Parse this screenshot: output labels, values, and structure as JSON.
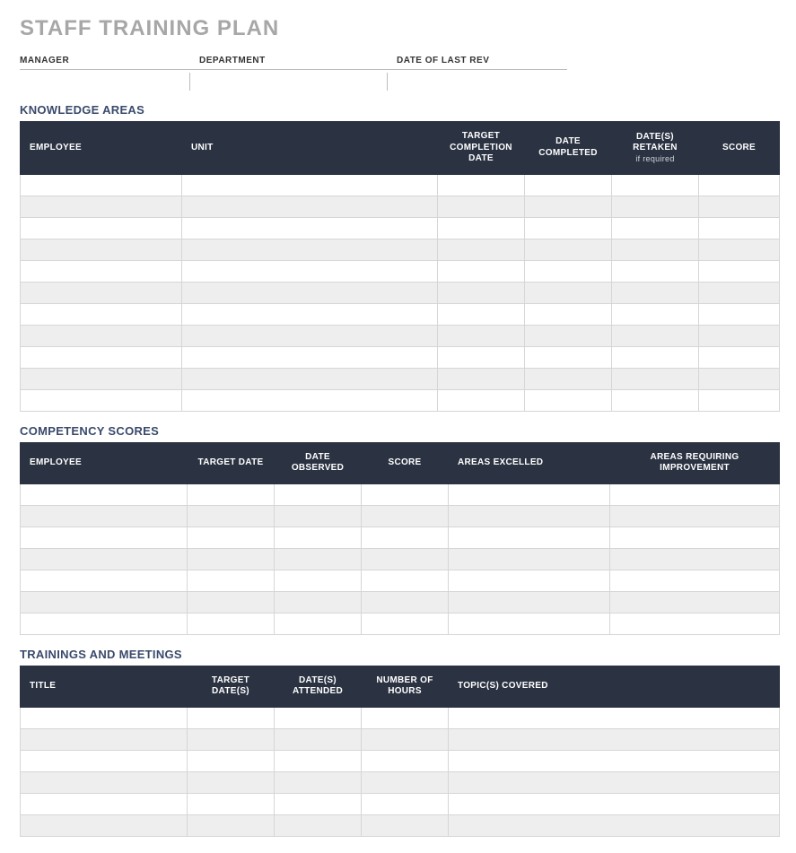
{
  "title": "STAFF TRAINING PLAN",
  "meta": {
    "manager_label": "MANAGER",
    "department_label": "DEPARTMENT",
    "date_last_rev_label": "DATE OF LAST REV",
    "manager_value": "",
    "department_value": "",
    "date_last_rev_value": ""
  },
  "sections": {
    "knowledge": {
      "heading": "KNOWLEDGE AREAS",
      "headers": {
        "employee": "EMPLOYEE",
        "unit": "UNIT",
        "target_completion": "TARGET COMPLETION DATE",
        "date_completed": "DATE COMPLETED",
        "dates_retaken": "DATE(S) RETAKEN",
        "dates_retaken_sub": "if required",
        "score": "SCORE"
      },
      "rows": [
        {
          "employee": "",
          "unit": "",
          "target_completion": "",
          "date_completed": "",
          "dates_retaken": "",
          "score": ""
        },
        {
          "employee": "",
          "unit": "",
          "target_completion": "",
          "date_completed": "",
          "dates_retaken": "",
          "score": ""
        },
        {
          "employee": "",
          "unit": "",
          "target_completion": "",
          "date_completed": "",
          "dates_retaken": "",
          "score": ""
        },
        {
          "employee": "",
          "unit": "",
          "target_completion": "",
          "date_completed": "",
          "dates_retaken": "",
          "score": ""
        },
        {
          "employee": "",
          "unit": "",
          "target_completion": "",
          "date_completed": "",
          "dates_retaken": "",
          "score": ""
        },
        {
          "employee": "",
          "unit": "",
          "target_completion": "",
          "date_completed": "",
          "dates_retaken": "",
          "score": ""
        },
        {
          "employee": "",
          "unit": "",
          "target_completion": "",
          "date_completed": "",
          "dates_retaken": "",
          "score": ""
        },
        {
          "employee": "",
          "unit": "",
          "target_completion": "",
          "date_completed": "",
          "dates_retaken": "",
          "score": ""
        },
        {
          "employee": "",
          "unit": "",
          "target_completion": "",
          "date_completed": "",
          "dates_retaken": "",
          "score": ""
        },
        {
          "employee": "",
          "unit": "",
          "target_completion": "",
          "date_completed": "",
          "dates_retaken": "",
          "score": ""
        },
        {
          "employee": "",
          "unit": "",
          "target_completion": "",
          "date_completed": "",
          "dates_retaken": "",
          "score": ""
        }
      ]
    },
    "competency": {
      "heading": "COMPETENCY SCORES",
      "headers": {
        "employee": "EMPLOYEE",
        "target_date": "TARGET DATE",
        "date_observed": "DATE OBSERVED",
        "score": "SCORE",
        "areas_excelled": "AREAS EXCELLED",
        "areas_improvement": "AREAS REQUIRING IMPROVEMENT"
      },
      "rows": [
        {
          "employee": "",
          "target_date": "",
          "date_observed": "",
          "score": "",
          "areas_excelled": "",
          "areas_improvement": ""
        },
        {
          "employee": "",
          "target_date": "",
          "date_observed": "",
          "score": "",
          "areas_excelled": "",
          "areas_improvement": ""
        },
        {
          "employee": "",
          "target_date": "",
          "date_observed": "",
          "score": "",
          "areas_excelled": "",
          "areas_improvement": ""
        },
        {
          "employee": "",
          "target_date": "",
          "date_observed": "",
          "score": "",
          "areas_excelled": "",
          "areas_improvement": ""
        },
        {
          "employee": "",
          "target_date": "",
          "date_observed": "",
          "score": "",
          "areas_excelled": "",
          "areas_improvement": ""
        },
        {
          "employee": "",
          "target_date": "",
          "date_observed": "",
          "score": "",
          "areas_excelled": "",
          "areas_improvement": ""
        },
        {
          "employee": "",
          "target_date": "",
          "date_observed": "",
          "score": "",
          "areas_excelled": "",
          "areas_improvement": ""
        }
      ]
    },
    "trainings": {
      "heading": "TRAININGS AND MEETINGS",
      "headers": {
        "title": "TITLE",
        "target_dates": "TARGET DATE(S)",
        "dates_attended": "DATE(S) ATTENDED",
        "number_of_hours": "NUMBER OF HOURS",
        "topics_covered": "TOPIC(S) COVERED"
      },
      "rows": [
        {
          "title": "",
          "target_dates": "",
          "dates_attended": "",
          "number_of_hours": "",
          "topics_covered": ""
        },
        {
          "title": "",
          "target_dates": "",
          "dates_attended": "",
          "number_of_hours": "",
          "topics_covered": ""
        },
        {
          "title": "",
          "target_dates": "",
          "dates_attended": "",
          "number_of_hours": "",
          "topics_covered": ""
        },
        {
          "title": "",
          "target_dates": "",
          "dates_attended": "",
          "number_of_hours": "",
          "topics_covered": ""
        },
        {
          "title": "",
          "target_dates": "",
          "dates_attended": "",
          "number_of_hours": "",
          "topics_covered": ""
        },
        {
          "title": "",
          "target_dates": "",
          "dates_attended": "",
          "number_of_hours": "",
          "topics_covered": ""
        }
      ]
    }
  }
}
